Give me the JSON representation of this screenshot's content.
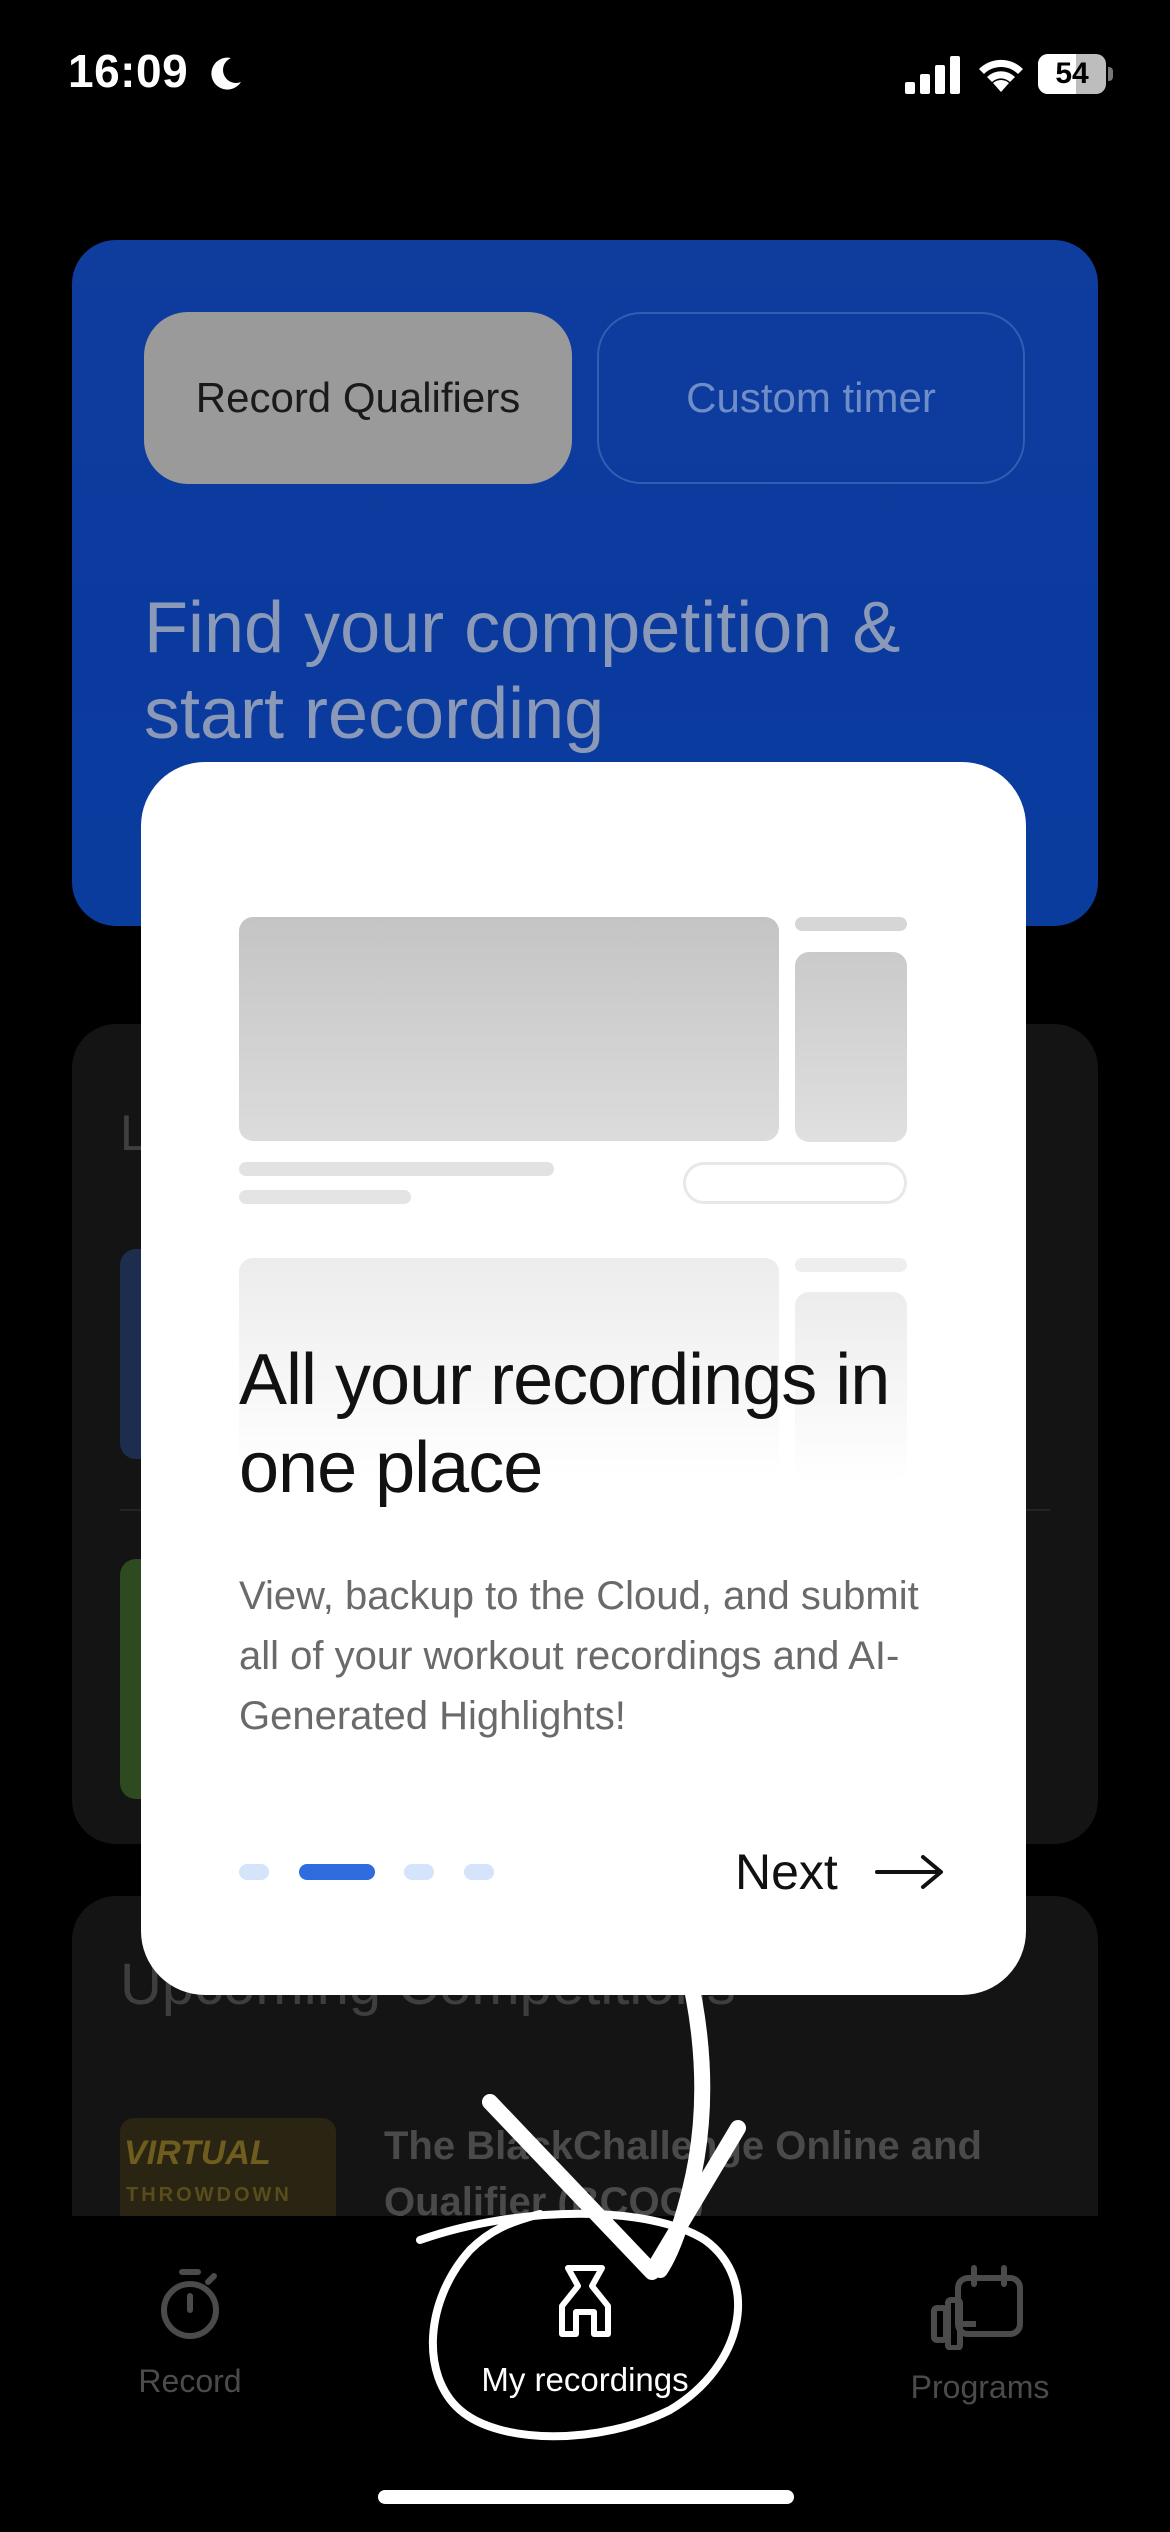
{
  "status_bar": {
    "time": "16:09",
    "battery": "54",
    "icons": [
      "moon-icon",
      "cellular-signal-icon",
      "wifi-icon",
      "battery-icon"
    ]
  },
  "background": {
    "hero": {
      "tab_record_qualifiers": "Record Qualifiers",
      "tab_custom_timer": "Custom timer",
      "title": "Find your competition & start recording"
    },
    "latest": {
      "label_partial": "L"
    },
    "upcoming": {
      "label": "Upcoming Competitions",
      "competition_title": "The BlackChallenge Online and Qualifier (BCOQ)",
      "thumb_text": "VIRTUAL",
      "thumb_subtext": "THROWDOWN"
    }
  },
  "modal": {
    "title": "All your recordings in one place",
    "body": "View, backup to the Cloud, and submit all of your workout recordings and AI-Generated Highlights!",
    "next_label": "Next",
    "pagination": {
      "total": 4,
      "active": 2
    }
  },
  "tabbar": {
    "items": [
      {
        "label": "Record",
        "icon": "stopwatch-icon"
      },
      {
        "label": "My recordings",
        "icon": "recordings-person-icon"
      },
      {
        "label": "Programs",
        "icon": "dumbbell-calendar-icon"
      }
    ]
  },
  "colors": {
    "hero_blue": "#0b3a9f",
    "active_dot": "#2f6cdf",
    "inactive_dot": "#d5e3fb"
  }
}
